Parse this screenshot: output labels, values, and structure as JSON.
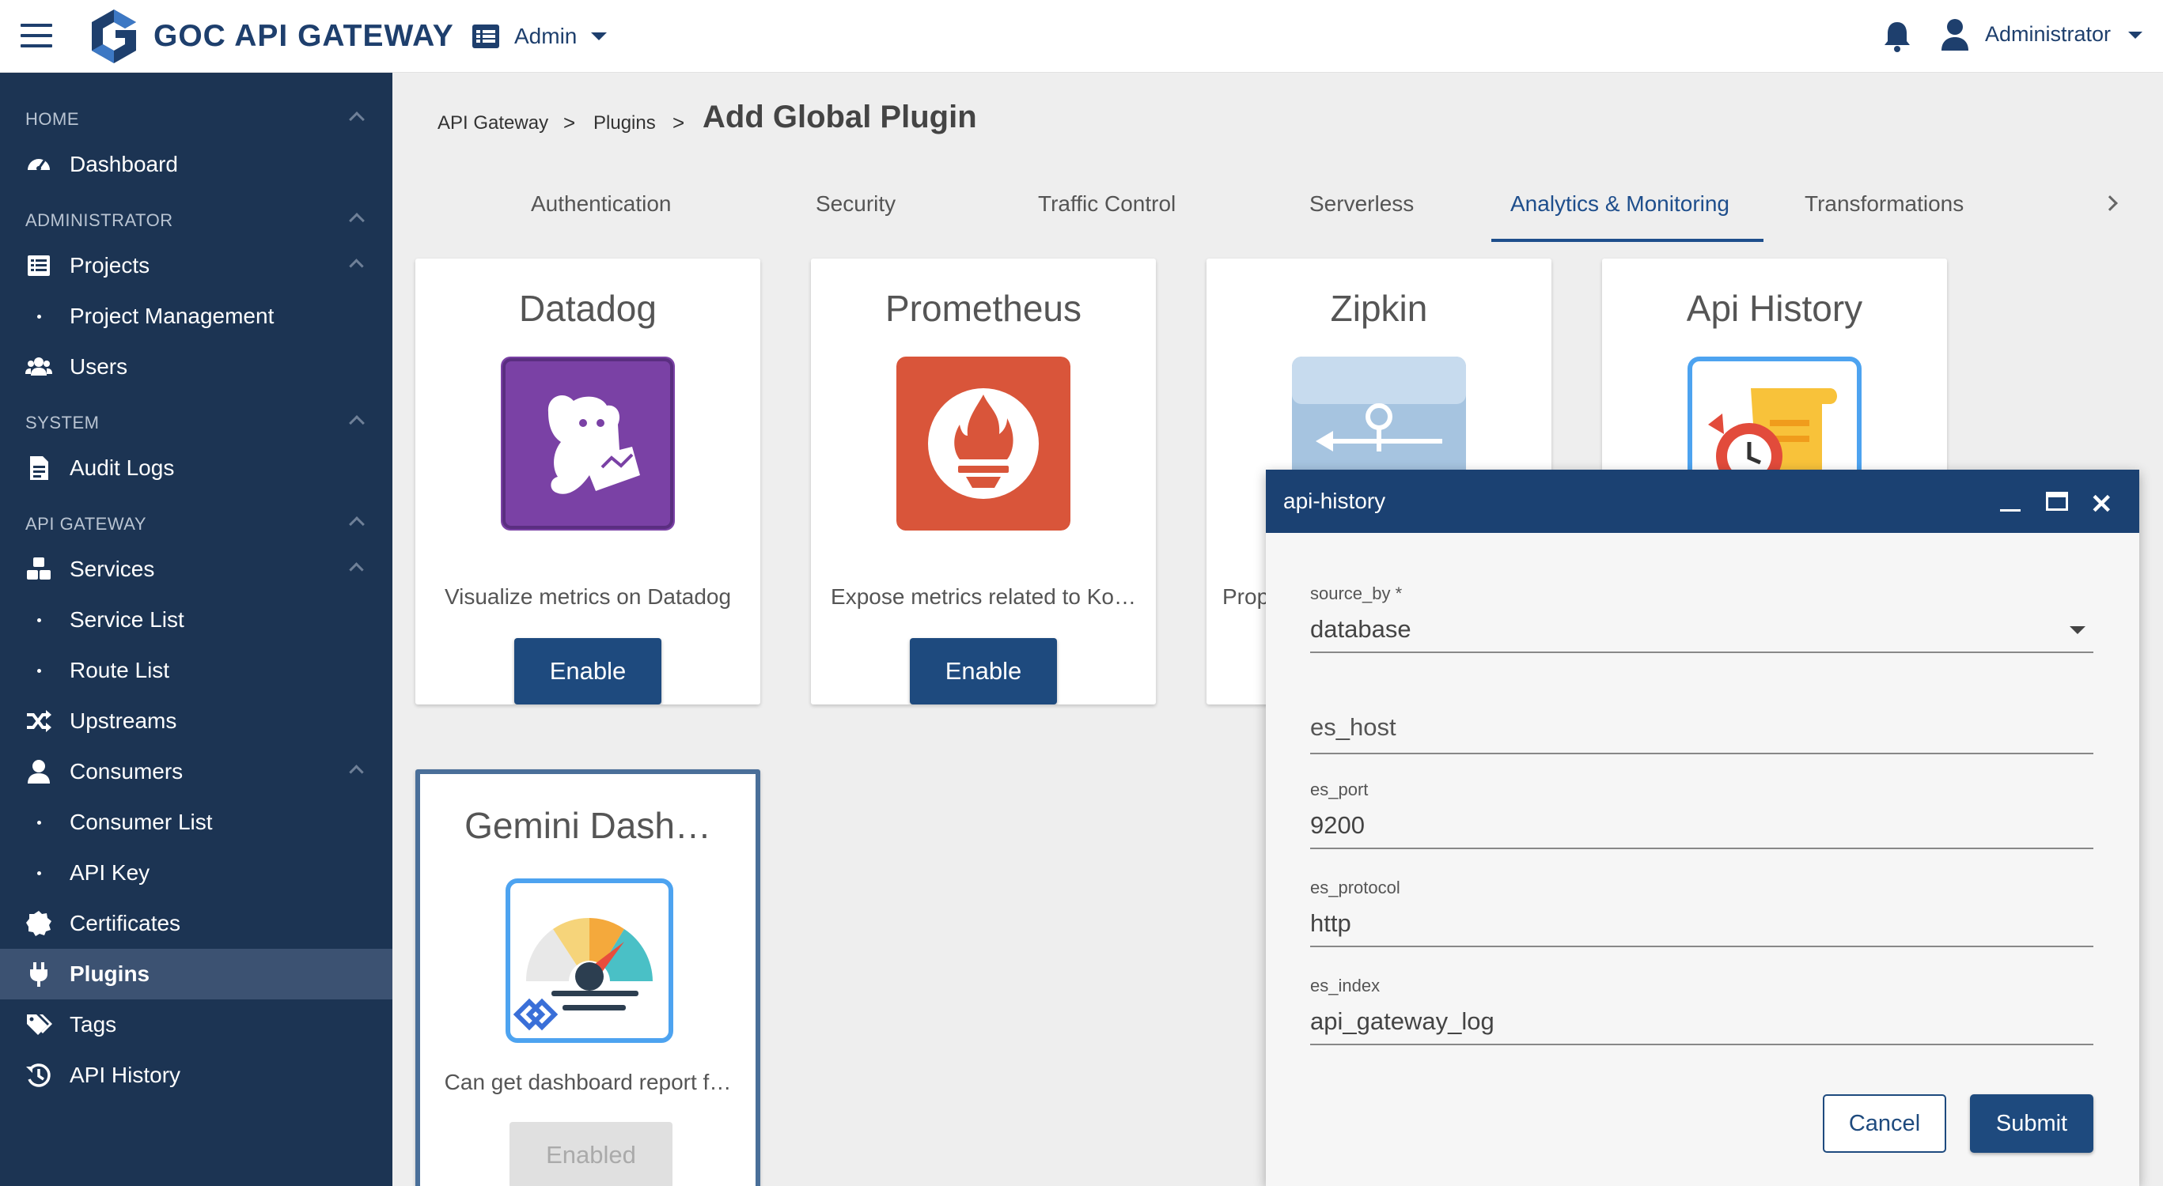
{
  "app": {
    "brand": "GOC API GATEWAY",
    "admin_switch": "Admin",
    "user_name": "Administrator",
    "colors": {
      "primary": "#1e3f6d",
      "sidebar": "#1c3453",
      "sidebar_active": "#3c5272",
      "button": "#1e4a7e"
    }
  },
  "sidebar": {
    "sections": {
      "home": "HOME",
      "administrator": "ADMINISTRATOR",
      "system": "SYSTEM",
      "api_gateway": "API GATEWAY"
    },
    "items": {
      "dashboard": "Dashboard",
      "projects": "Projects",
      "project_management": "Project Management",
      "users": "Users",
      "audit_logs": "Audit Logs",
      "services": "Services",
      "service_list": "Service List",
      "route_list": "Route List",
      "upstreams": "Upstreams",
      "consumers": "Consumers",
      "consumer_list": "Consumer List",
      "api_key": "API Key",
      "certificates": "Certificates",
      "plugins": "Plugins",
      "tags": "Tags",
      "api_history": "API History"
    },
    "active_item": "Plugins"
  },
  "breadcrumb": {
    "items": [
      "API Gateway",
      "Plugins"
    ],
    "separator": ">",
    "current": "Add Global Plugin"
  },
  "tabs": {
    "items": [
      "Authentication",
      "Security",
      "Traffic Control",
      "Serverless",
      "Analytics & Monitoring",
      "Transformations"
    ],
    "active": "Analytics & Monitoring"
  },
  "plugins": [
    {
      "title": "Datadog",
      "description": "Visualize metrics on Datadog",
      "button": "Enable",
      "icon": "datadog-icon"
    },
    {
      "title": "Prometheus",
      "description": "Expose metrics related to Ko…",
      "button": "Enable",
      "icon": "prometheus-icon"
    },
    {
      "title": "Zipkin",
      "description": "Prop",
      "icon": "zipkin-icon"
    },
    {
      "title": "Api History",
      "icon": "api-history-icon"
    },
    {
      "title": "Gemini Dash…",
      "description": "Can get dashboard report f…",
      "button": "Enabled",
      "icon": "gemini-dashboard-icon"
    }
  ],
  "modal": {
    "title": "api-history",
    "fields": {
      "source_by": {
        "label": "source_by *",
        "value": "database"
      },
      "es_host": {
        "placeholder": "es_host"
      },
      "es_port": {
        "label": "es_port",
        "value": "9200"
      },
      "es_protocol": {
        "label": "es_protocol",
        "value": "http"
      },
      "es_index": {
        "label": "es_index",
        "value": "api_gateway_log"
      }
    },
    "cancel": "Cancel",
    "submit": "Submit"
  }
}
